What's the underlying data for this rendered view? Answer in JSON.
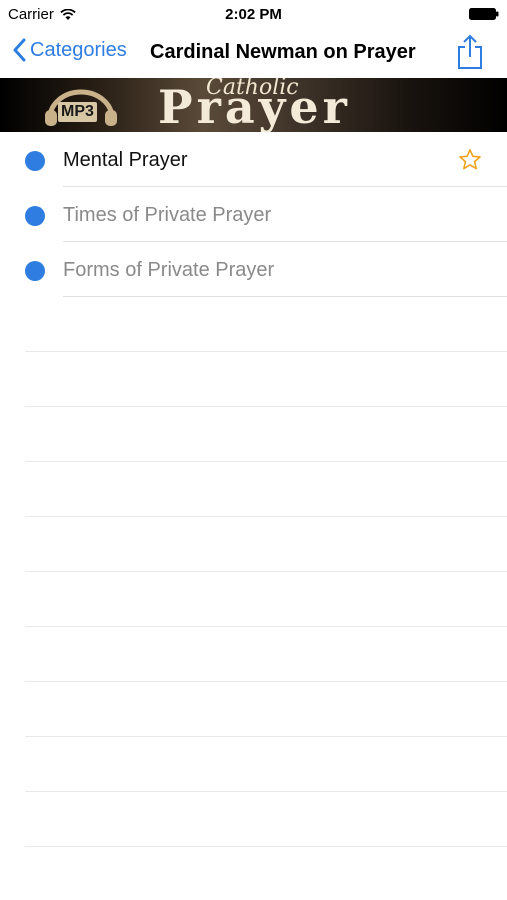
{
  "status_bar": {
    "carrier": "Carrier",
    "time": "2:02 PM"
  },
  "nav": {
    "back_label": "Categories",
    "title": "Cardinal Newman on Prayer"
  },
  "banner": {
    "badge": "MP3",
    "line1": "Catholic",
    "line2": "Prayer"
  },
  "list": {
    "items": [
      {
        "label": "Mental Prayer",
        "favorite_icon": "star-outline-icon"
      },
      {
        "label": "Times of Private Prayer"
      },
      {
        "label": "Forms of Private Prayer"
      }
    ]
  },
  "colors": {
    "accent": "#2f7de1",
    "star": "#f0a21f"
  }
}
